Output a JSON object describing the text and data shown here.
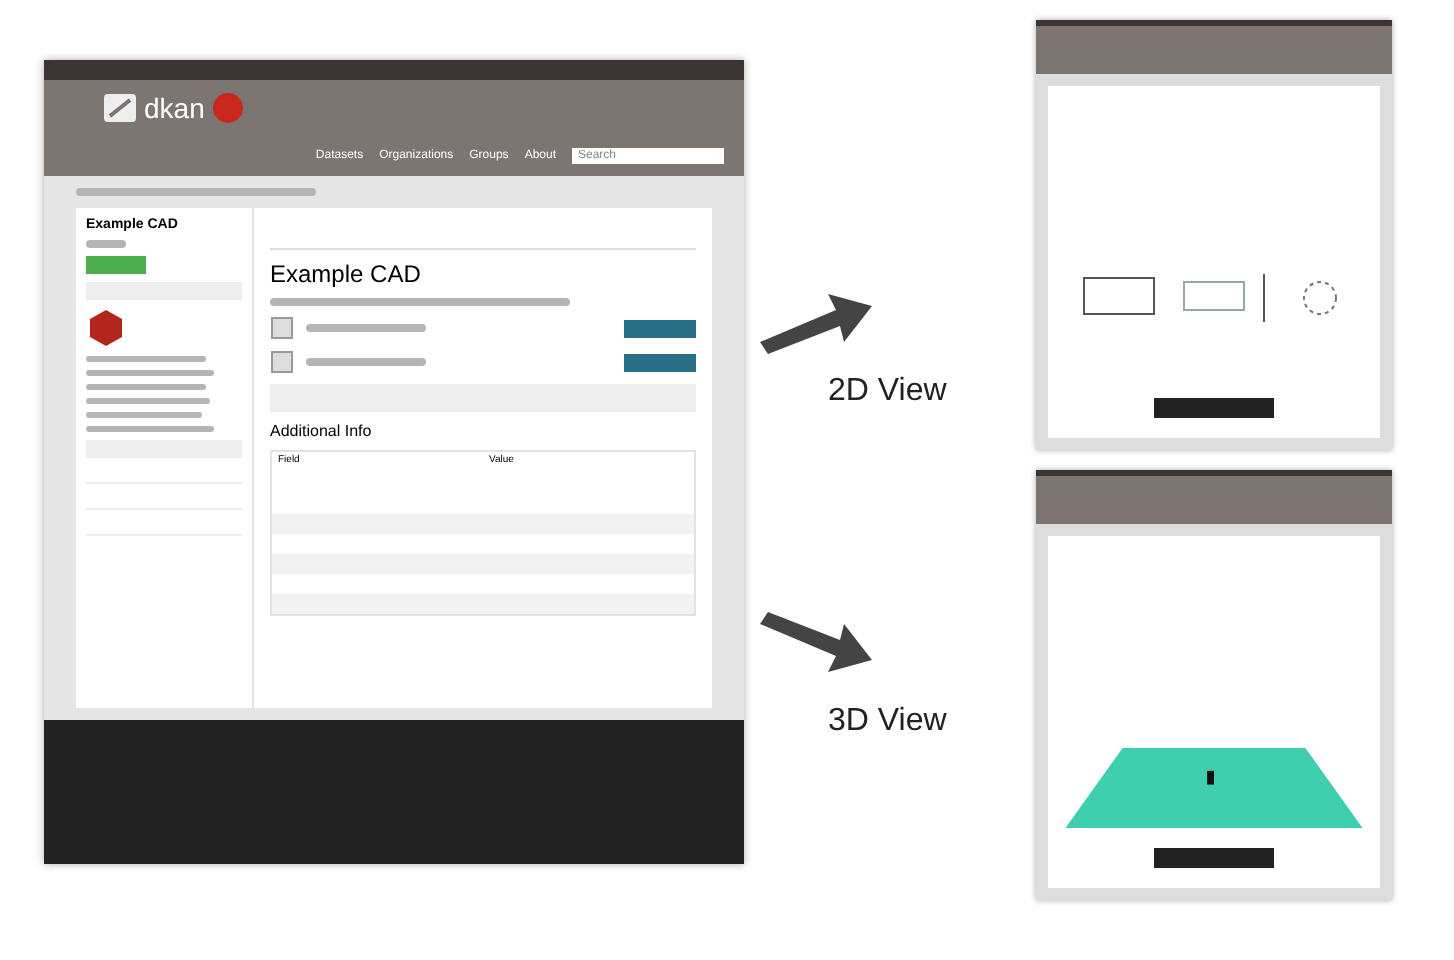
{
  "main_screen": {
    "logo": "dkan",
    "nav": [
      "Datasets",
      "Organizations",
      "Groups",
      "About"
    ],
    "search": {
      "placeholder": "Search"
    },
    "sidebar_title": "Example CAD",
    "title": "Example CAD",
    "additional_info": {
      "heading": "Additional Info",
      "columns": [
        "Field",
        "Value"
      ]
    }
  },
  "views": [
    {
      "label": "2D View",
      "kind": "plan"
    },
    {
      "label": "3D View",
      "kind": "model"
    }
  ]
}
